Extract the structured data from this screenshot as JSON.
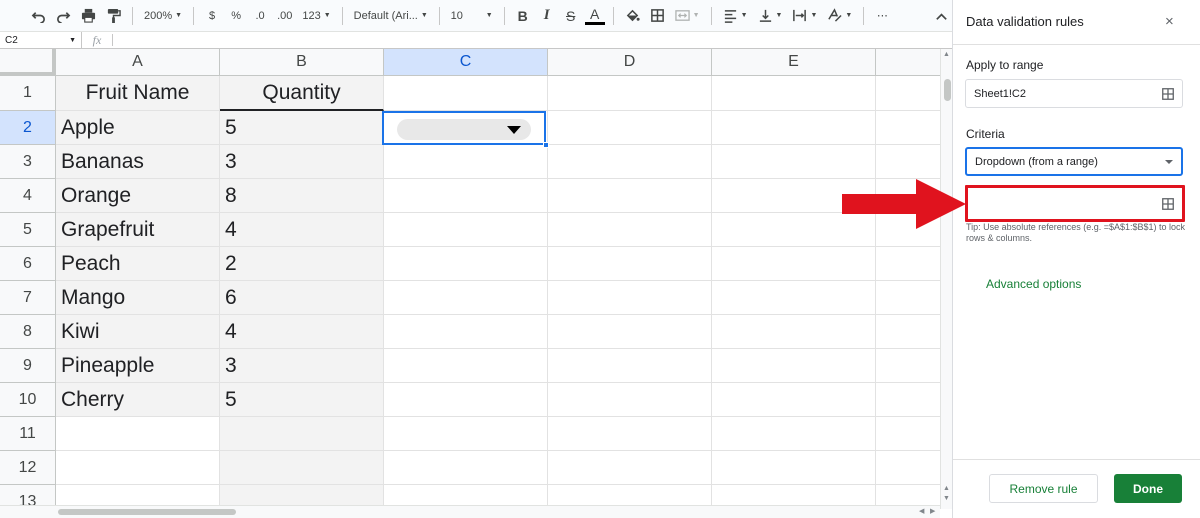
{
  "toolbar": {
    "zoom": "200%",
    "currency": "$",
    "percent": "%",
    "decrease_decimal": ".0",
    "increase_decimal": ".00",
    "number_format": "123",
    "font": "Default (Ari...",
    "font_size": "10",
    "bold": "B",
    "italic": "I",
    "strike": "S",
    "text_color": "A",
    "more": "⋯"
  },
  "formula_bar": {
    "cell_ref": "C2",
    "fx": "fx"
  },
  "sheet": {
    "columns": [
      "A",
      "B",
      "C",
      "D",
      "E"
    ],
    "rows": [
      "1",
      "2",
      "3",
      "4",
      "5",
      "6",
      "7",
      "8",
      "9",
      "10",
      "11",
      "12",
      "13"
    ],
    "header": {
      "a": "Fruit Name",
      "b": "Quantity"
    },
    "data": [
      {
        "fruit": "Apple",
        "qty": "5"
      },
      {
        "fruit": "Bananas",
        "qty": "3"
      },
      {
        "fruit": "Orange",
        "qty": "8"
      },
      {
        "fruit": "Grapefruit",
        "qty": "4"
      },
      {
        "fruit": "Peach",
        "qty": "2"
      },
      {
        "fruit": "Mango",
        "qty": "6"
      },
      {
        "fruit": "Kiwi",
        "qty": "4"
      },
      {
        "fruit": "Pineapple",
        "qty": "3"
      },
      {
        "fruit": "Cherry",
        "qty": "5"
      }
    ]
  },
  "panel": {
    "title": "Data validation rules",
    "close": "×",
    "apply_label": "Apply to range",
    "apply_value": "Sheet1!C2",
    "criteria_label": "Criteria",
    "criteria_value": "Dropdown (from a range)",
    "range_value": "",
    "tip": "Tip: Use absolute references (e.g. =$A$1:$B$1) to lock rows & columns.",
    "advanced": "Advanced options",
    "remove_btn": "Remove rule",
    "done_btn": "Done"
  },
  "colors": {
    "accent_blue": "#1a73e8",
    "green": "#188038",
    "annotation_red": "#e0131e"
  }
}
